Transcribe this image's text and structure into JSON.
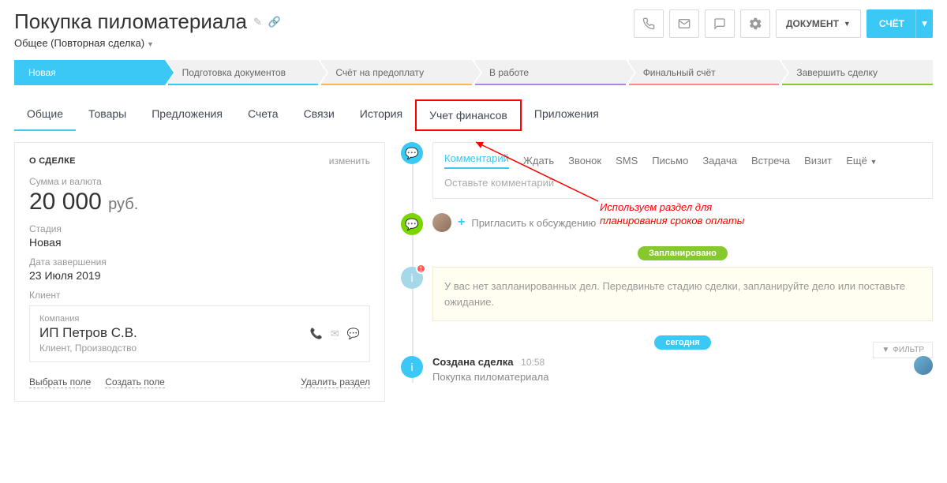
{
  "header": {
    "title": "Покупка пиломатериала",
    "subtitle": "Общее (Повторная сделка)",
    "doc_button": "ДОКУМЕНТ",
    "invoice_button": "СЧЁТ"
  },
  "stages": [
    {
      "label": "Новая",
      "active": true,
      "underline": ""
    },
    {
      "label": "Подготовка документов",
      "underline": "#3bc8f5"
    },
    {
      "label": "Счёт на предоплату",
      "underline": "#ffb74e"
    },
    {
      "label": "В работе",
      "underline": "#b084d8"
    },
    {
      "label": "Финальный счёт",
      "underline": "#ff8a8a"
    },
    {
      "label": "Завершить сделку",
      "underline": "#86c82d"
    }
  ],
  "tabs": [
    "Общие",
    "Товары",
    "Предложения",
    "Счета",
    "Связи",
    "История",
    "Учет финансов",
    "Приложения"
  ],
  "active_tab": 0,
  "highlight_tab": 6,
  "deal": {
    "section_title": "О СДЕЛКЕ",
    "edit": "изменить",
    "amount_label": "Сумма и валюта",
    "amount": "20 000",
    "currency": "руб.",
    "stage_label": "Стадия",
    "stage_value": "Новая",
    "end_label": "Дата завершения",
    "end_value": "23 Июля 2019",
    "client_label": "Клиент",
    "company_label": "Компания",
    "company_name": "ИП Петров С.В.",
    "company_sub": "Клиент, Производство",
    "select_field": "Выбрать поле",
    "create_field": "Создать поле",
    "delete_section": "Удалить раздел"
  },
  "comment": {
    "tabs": [
      "Комментарий",
      "Ждать",
      "Звонок",
      "SMS",
      "Письмо",
      "Задача",
      "Встреча",
      "Визит"
    ],
    "more": "Ещё",
    "placeholder": "Оставьте комментарий",
    "invite": "Пригласить к обсуждению"
  },
  "planned": {
    "pill": "Запланировано",
    "text": "У вас нет запланированных дел. Передвиньте стадию сделки, запланируйте дело или поставьте ожидание."
  },
  "today_pill": "сегодня",
  "filter": "ФИЛЬТР",
  "event": {
    "title": "Создана сделка",
    "time": "10:58",
    "sub": "Покупка пиломатериала"
  },
  "annotation": "Используем раздел для планирования сроков оплаты"
}
